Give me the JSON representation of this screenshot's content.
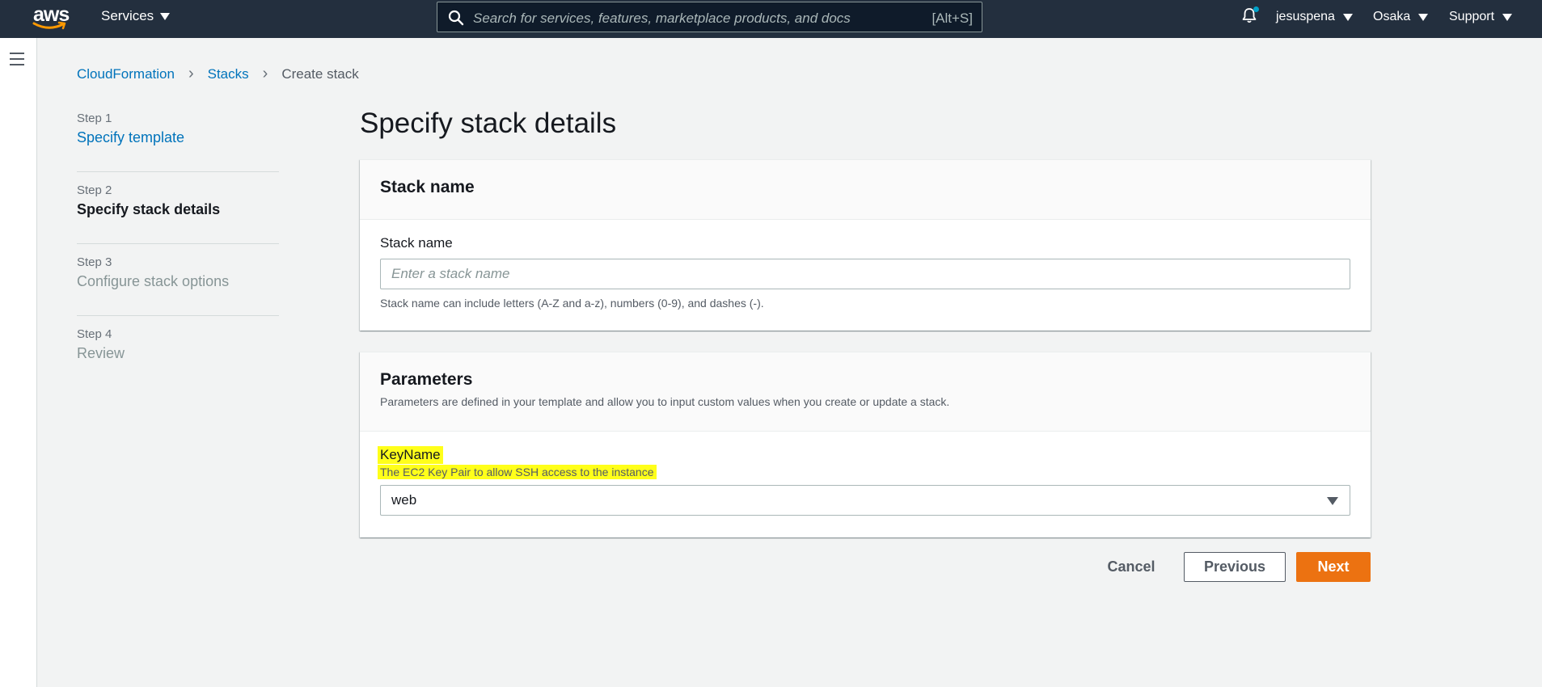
{
  "nav": {
    "logo_text": "aws",
    "services_label": "Services",
    "search_placeholder": "Search for services, features, marketplace products, and docs",
    "search_shortcut": "[Alt+S]",
    "user": "jesuspena",
    "region": "Osaka",
    "support": "Support",
    "notification_dot_color": "#00a1c9"
  },
  "breadcrumb": {
    "items": [
      "CloudFormation",
      "Stacks"
    ],
    "current": "Create stack"
  },
  "steps": [
    {
      "num": "Step 1",
      "label": "Specify template"
    },
    {
      "num": "Step 2",
      "label": "Specify stack details"
    },
    {
      "num": "Step 3",
      "label": "Configure stack options"
    },
    {
      "num": "Step 4",
      "label": "Review"
    }
  ],
  "page_title": "Specify stack details",
  "stack_name_panel": {
    "title": "Stack name",
    "field_label": "Stack name",
    "placeholder": "Enter a stack name",
    "hint": "Stack name can include letters (A-Z and a-z), numbers (0-9), and dashes (-)."
  },
  "parameters_panel": {
    "title": "Parameters",
    "description": "Parameters are defined in your template and allow you to input custom values when you create or update a stack.",
    "param_name": "KeyName",
    "param_description": "The EC2 Key Pair to allow SSH access to the instance",
    "selected_value": "web",
    "highlight_color": "#ffff1a"
  },
  "actions": {
    "cancel": "Cancel",
    "previous": "Previous",
    "next": "Next",
    "primary_color": "#ec7211"
  }
}
